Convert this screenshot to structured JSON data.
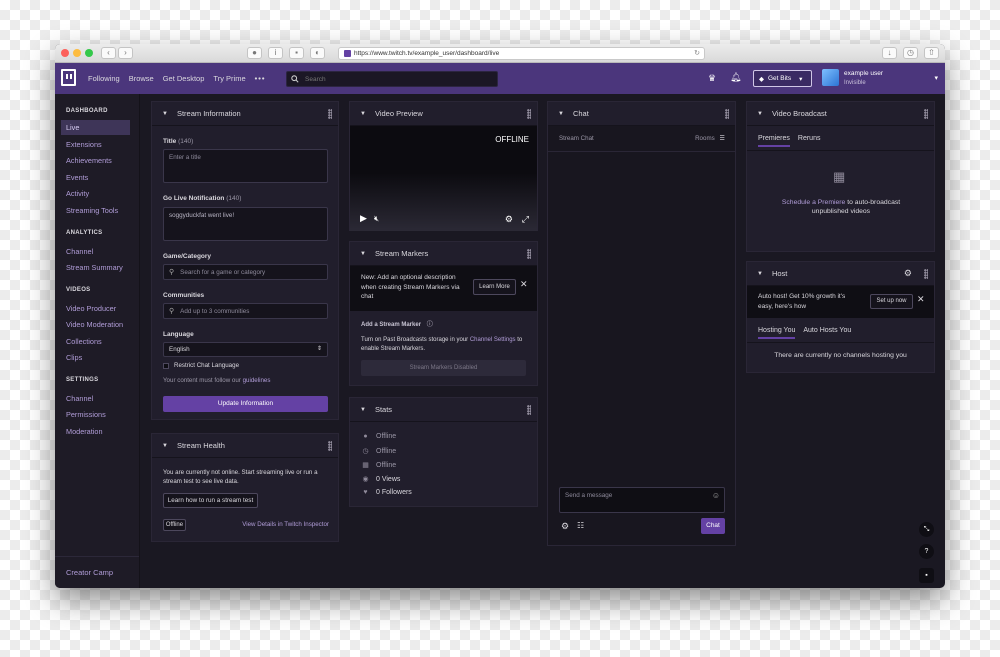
{
  "browser": {
    "url": "https://www.twitch.tv/example_user/dashboard/live",
    "traffic_colors": [
      "#fc605b",
      "#fdbc40",
      "#34c84a"
    ]
  },
  "topnav": {
    "links": [
      "Following",
      "Browse",
      "Get Desktop",
      "Try Prime"
    ],
    "more": "•••",
    "search_placeholder": "Search",
    "get_bits": "Get Bits",
    "username": "example user",
    "user_status": "Invisible"
  },
  "sidebar": {
    "dashboard_heading": "DASHBOARD",
    "dashboard_items": [
      "Live",
      "Extensions",
      "Achievements",
      "Events",
      "Activity",
      "Streaming Tools"
    ],
    "analytics_heading": "ANALYTICS",
    "analytics_items": [
      "Channel",
      "Stream Summary"
    ],
    "videos_heading": "VIDEOS",
    "videos_items": [
      "Video Producer",
      "Video Moderation",
      "Collections",
      "Clips"
    ],
    "settings_heading": "SETTINGS",
    "settings_items": [
      "Channel",
      "Permissions",
      "Moderation"
    ],
    "creator_camp": "Creator Camp"
  },
  "stream_info": {
    "title": "Stream Information",
    "title_label": "Title",
    "title_count": "(140)",
    "title_placeholder": "Enter a title",
    "notif_label": "Go Live Notification",
    "notif_count": "(140)",
    "notif_value": "soggyduckfat went live!",
    "game_label": "Game/Category",
    "game_placeholder": "Search for a game or category",
    "communities_label": "Communities",
    "communities_placeholder": "Add up to 3 communities",
    "language_label": "Language",
    "language_value": "English",
    "restrict_label": "Restrict Chat Language",
    "guidelines_prefix": "Your content must follow our ",
    "guidelines_link": "guidelines",
    "update_button": "Update Information"
  },
  "stream_health": {
    "title": "Stream Health",
    "message": "You are currently not online. Start streaming live or run a stream test to see live data.",
    "learn_button": "Learn how to run a stream test",
    "status": "Offline",
    "inspector_link": "View Details in Twitch Inspector"
  },
  "video_preview": {
    "title": "Video Preview",
    "offline": "OFFLINE"
  },
  "stream_markers": {
    "title": "Stream Markers",
    "promo": "New: Add an optional description when creating Stream Markers via chat",
    "learn_more": "Learn More",
    "add_label": "Add a Stream Marker",
    "info_prefix": "Turn on Past Broadcasts storage in your ",
    "info_link": "Channel Settings",
    "info_suffix": " to enable Stream Markers.",
    "disabled_button": "Stream Markers Disabled"
  },
  "stats": {
    "title": "Stats",
    "rows": [
      "Offline",
      "Offline",
      "Offline",
      "0 Views",
      "0 Followers"
    ],
    "icons": [
      "person-icon",
      "clock-icon",
      "film-icon",
      "eye-icon",
      "heart-icon"
    ]
  },
  "chat": {
    "title": "Chat",
    "stream_chat": "Stream Chat",
    "rooms": "Rooms",
    "send_placeholder": "Send a message",
    "chat_button": "Chat"
  },
  "video_broadcast": {
    "title": "Video Broadcast",
    "tabs": [
      "Premieres",
      "Reruns"
    ],
    "schedule_link": "Schedule a Premiere",
    "schedule_rest": " to auto-broadcast unpublished videos"
  },
  "host": {
    "title": "Host",
    "promo": "Auto host! Get 10% growth it's easy, here's how",
    "setup_button": "Set up now",
    "tabs": [
      "Hosting You",
      "Auto Hosts You"
    ],
    "empty": "There are currently no channels hosting you"
  },
  "floating": {
    "help": "?"
  },
  "colors": {
    "brand": "#6441a4",
    "topnav": "#4b367c",
    "panel": "#211e2c",
    "link": "#b19dd8"
  }
}
